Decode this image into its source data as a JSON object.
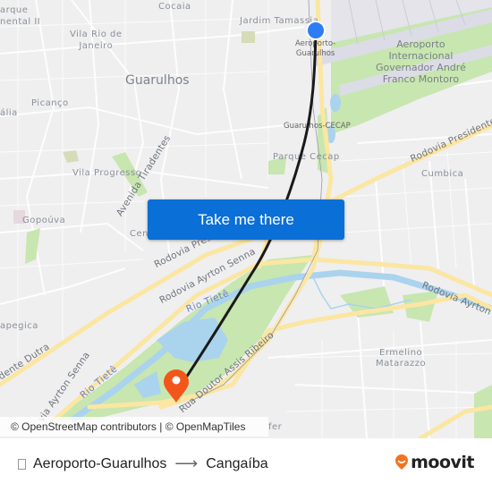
{
  "map": {
    "labels": {
      "parque_continental": "arque\nnental II",
      "cocaia": "Cocaia",
      "jardim_tamassia": "Jardim Tamassia",
      "vila_rio_de_janeiro": "Vila Rio de\nJaneiro",
      "guarulhos": "Guarulhos",
      "picanco": "Picanço",
      "vila_galvao": "ália",
      "airport": "Aeroporto\nInternacional\nGovernador André\nFranco Montoro",
      "stop_aeroporto": "Aeroporto-\nGuarulhos",
      "stop_cecap": "Guarulhos-CECAP",
      "parque_cecap": "Parque Cecap",
      "cumbica": "Cumbica",
      "vila_progresso": "Vila Progresso",
      "gopouva": "Gopoúva",
      "centro": "Cen",
      "itapegica": "apegica",
      "ermelino": "Ermelino\nMatarazzo",
      "cangaiba_partial": "fer"
    },
    "roads": {
      "av_tiradentes": "Avenida Tiradentes",
      "rod_presidente_dutra_center": "Rodovia Presid",
      "rod_presidente_dutra_east": "Rodovia Presidente",
      "rod_presidente_dutra_west": "idente Dutra",
      "rod_ayrton_senna_center": "Rodovia Ayrton Senna",
      "rod_ayrton_senna_east": "Rodovia Ayrton S",
      "rod_ayrton_senna_west": "via Ayrton Senna",
      "rua_assis_ribeiro": "Rua Doutor Assis Ribeiro"
    },
    "rivers": {
      "rio_tiete_1": "Rio Tietê",
      "rio_tiete_2": "Rio Tietê"
    },
    "colors": {
      "origin_marker": "#2d7cf6",
      "destination_marker": "#f3561b",
      "route_line": "#1a1a1a",
      "highway": "#fbe6a2",
      "park": "#c8e6b0",
      "water": "#aad3ee"
    }
  },
  "cta": {
    "label": "Take me there"
  },
  "attribution": {
    "osm": "© OpenStreetMap contributors",
    "separator": " | ",
    "omt": "© OpenMapTiles"
  },
  "footer": {
    "origin": "Aeroporto-Guarulhos",
    "arrow": "⟶",
    "destination": "Cangaíba",
    "brand": "moovit",
    "brand_color": "#f4731f"
  }
}
